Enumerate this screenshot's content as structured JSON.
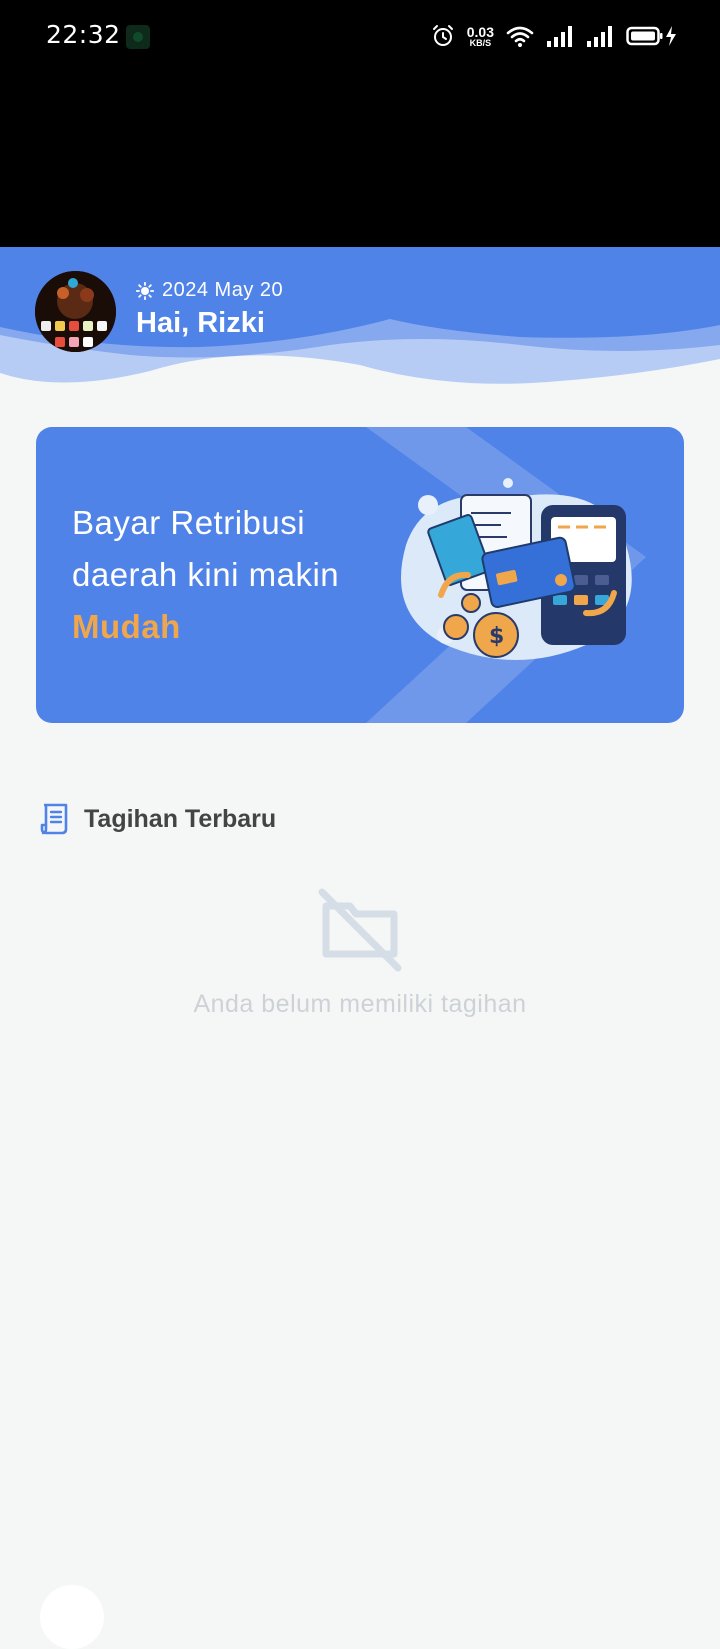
{
  "status_bar": {
    "time": "22:32",
    "net_speed_value": "0.03",
    "net_speed_unit": "KB/S",
    "icons": [
      "alarm-icon",
      "wifi-icon",
      "signal-icon",
      "signal-icon",
      "battery-charging-icon"
    ]
  },
  "header": {
    "date": "2024 May 20",
    "greeting": "Hai, Rizki",
    "weather_icon": "sun-icon"
  },
  "banner": {
    "line1": "Bayar Retribusi",
    "line2": "daerah kini makin",
    "highlight": "Mudah"
  },
  "section": {
    "title": "Tagihan Terbaru",
    "icon": "receipt-icon"
  },
  "empty_state": {
    "message": "Anda belum memiliki tagihan",
    "icon": "empty-folder-icon"
  },
  "colors": {
    "primary": "#5083e8",
    "accent": "#f0a64a",
    "background": "#f5f7f7",
    "muted_text": "#cdd2d6"
  }
}
